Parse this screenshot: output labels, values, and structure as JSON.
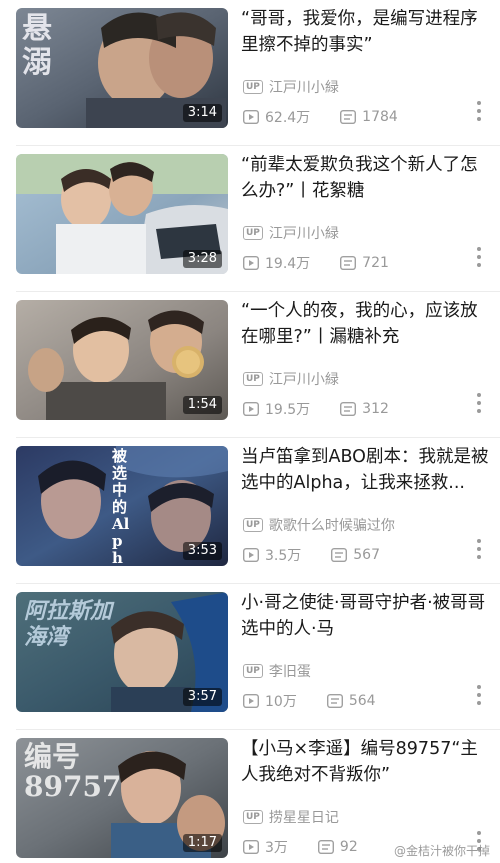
{
  "videos": [
    {
      "title": "“哥哥，我爱你，是编写进程序里擦不掉的事实”",
      "duration": "3:14",
      "uploader": "江戸川小緑",
      "plays": "62.4万",
      "comments": "1784",
      "thumb_text": "悬溺"
    },
    {
      "title": "“前辈太爱欺负我这个新人了怎么办?”丨花絮糖",
      "duration": "3:28",
      "uploader": "江戸川小緑",
      "plays": "19.4万",
      "comments": "721",
      "thumb_text": ""
    },
    {
      "title": "“一个人的夜，我的心，应该放在哪里?”丨漏糖补充",
      "duration": "1:54",
      "uploader": "江戸川小緑",
      "plays": "19.5万",
      "comments": "312",
      "thumb_text": ""
    },
    {
      "title": "当卢笛拿到ABO剧本：我就是被选中的Alpha，让我来拯救...",
      "duration": "3:53",
      "uploader": "歌歌什么时候骗过你",
      "plays": "3.5万",
      "comments": "567",
      "thumb_text": "被选中的Alpha"
    },
    {
      "title": "小·哥之使徒·哥哥守护者·被哥哥选中的人·马",
      "duration": "3:57",
      "uploader": "李旧蛋",
      "plays": "10万",
      "comments": "564",
      "thumb_text": "阿拉斯加海湾"
    },
    {
      "title": "【小马×李遥】编号89757“主人我绝对不背叛你”",
      "duration": "1:17",
      "uploader": "捞星星日记",
      "plays": "3万",
      "comments": "92",
      "thumb_text": "编号89757"
    }
  ],
  "badge": {
    "up": "UP"
  },
  "watermark": "@金桔汁被你干掉",
  "icons": {
    "play": "play-icon",
    "comment": "danmaku-icon",
    "more": "more-vertical-icon"
  },
  "colors": {
    "meta": "#999999",
    "title": "#1a1a1a",
    "divider": "#ececec"
  }
}
